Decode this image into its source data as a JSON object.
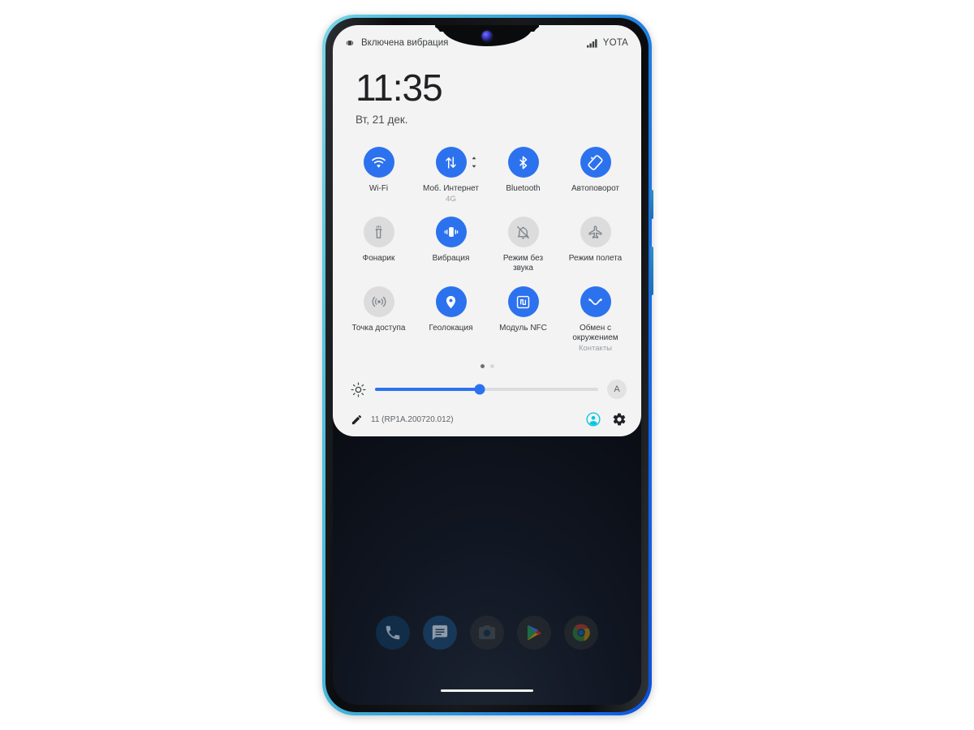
{
  "device": {
    "frame_color": "#2a8fd0",
    "accent_blue": "#2c72ee",
    "inactive_grey": "#dcdcdc",
    "account_cyan": "#00c8e0"
  },
  "statusbar": {
    "vibration_text": "Включена вибрация",
    "vibration_icon": "vibration-icon",
    "signal_icon": "signal-bars-icon",
    "carrier": "YOTA"
  },
  "clock": {
    "time": "11:35",
    "date": "Вт, 21 дек."
  },
  "quick_settings": {
    "tiles": [
      {
        "label": "Wi-Fi",
        "sub": "",
        "state": "on",
        "icon": "wifi-icon"
      },
      {
        "label": "Моб. Интернет",
        "sub": "4G",
        "state": "on",
        "icon": "mobile-data-icon"
      },
      {
        "label": "Bluetooth",
        "sub": "",
        "state": "on",
        "icon": "bluetooth-icon"
      },
      {
        "label": "Автоповорот",
        "sub": "",
        "state": "on",
        "icon": "auto-rotate-icon"
      },
      {
        "label": "Фонарик",
        "sub": "",
        "state": "off",
        "icon": "flashlight-icon"
      },
      {
        "label": "Вибрация",
        "sub": "",
        "state": "on",
        "icon": "vibrate-icon"
      },
      {
        "label": "Режим без звука",
        "sub": "",
        "state": "off",
        "icon": "silent-bell-icon"
      },
      {
        "label": "Режим полета",
        "sub": "",
        "state": "off",
        "icon": "airplane-icon"
      },
      {
        "label": "Точка доступа",
        "sub": "",
        "state": "off",
        "icon": "hotspot-icon"
      },
      {
        "label": "Геолокация",
        "sub": "",
        "state": "on",
        "icon": "location-pin-icon"
      },
      {
        "label": "Модуль NFC",
        "sub": "",
        "state": "on",
        "icon": "nfc-icon"
      },
      {
        "label": "Обмен с окружением",
        "sub": "Контакты",
        "state": "on",
        "icon": "nearby-share-icon"
      }
    ],
    "page_dots": {
      "count": 2,
      "active_index": 0
    }
  },
  "brightness": {
    "icon": "brightness-icon",
    "value_percent": 47,
    "auto_label": "A"
  },
  "footer": {
    "edit_icon": "pencil-icon",
    "build": "11 (RP1A.200720.012)",
    "account_icon": "account-circle-icon",
    "settings_icon": "gear-icon"
  },
  "dock": {
    "apps": [
      {
        "name": "phone-app",
        "icon": "phone-icon"
      },
      {
        "name": "messages-app",
        "icon": "messages-icon"
      },
      {
        "name": "camera-app",
        "icon": "camera-icon"
      },
      {
        "name": "play-store-app",
        "icon": "play-store-icon"
      },
      {
        "name": "chrome-app",
        "icon": "chrome-icon"
      }
    ]
  }
}
